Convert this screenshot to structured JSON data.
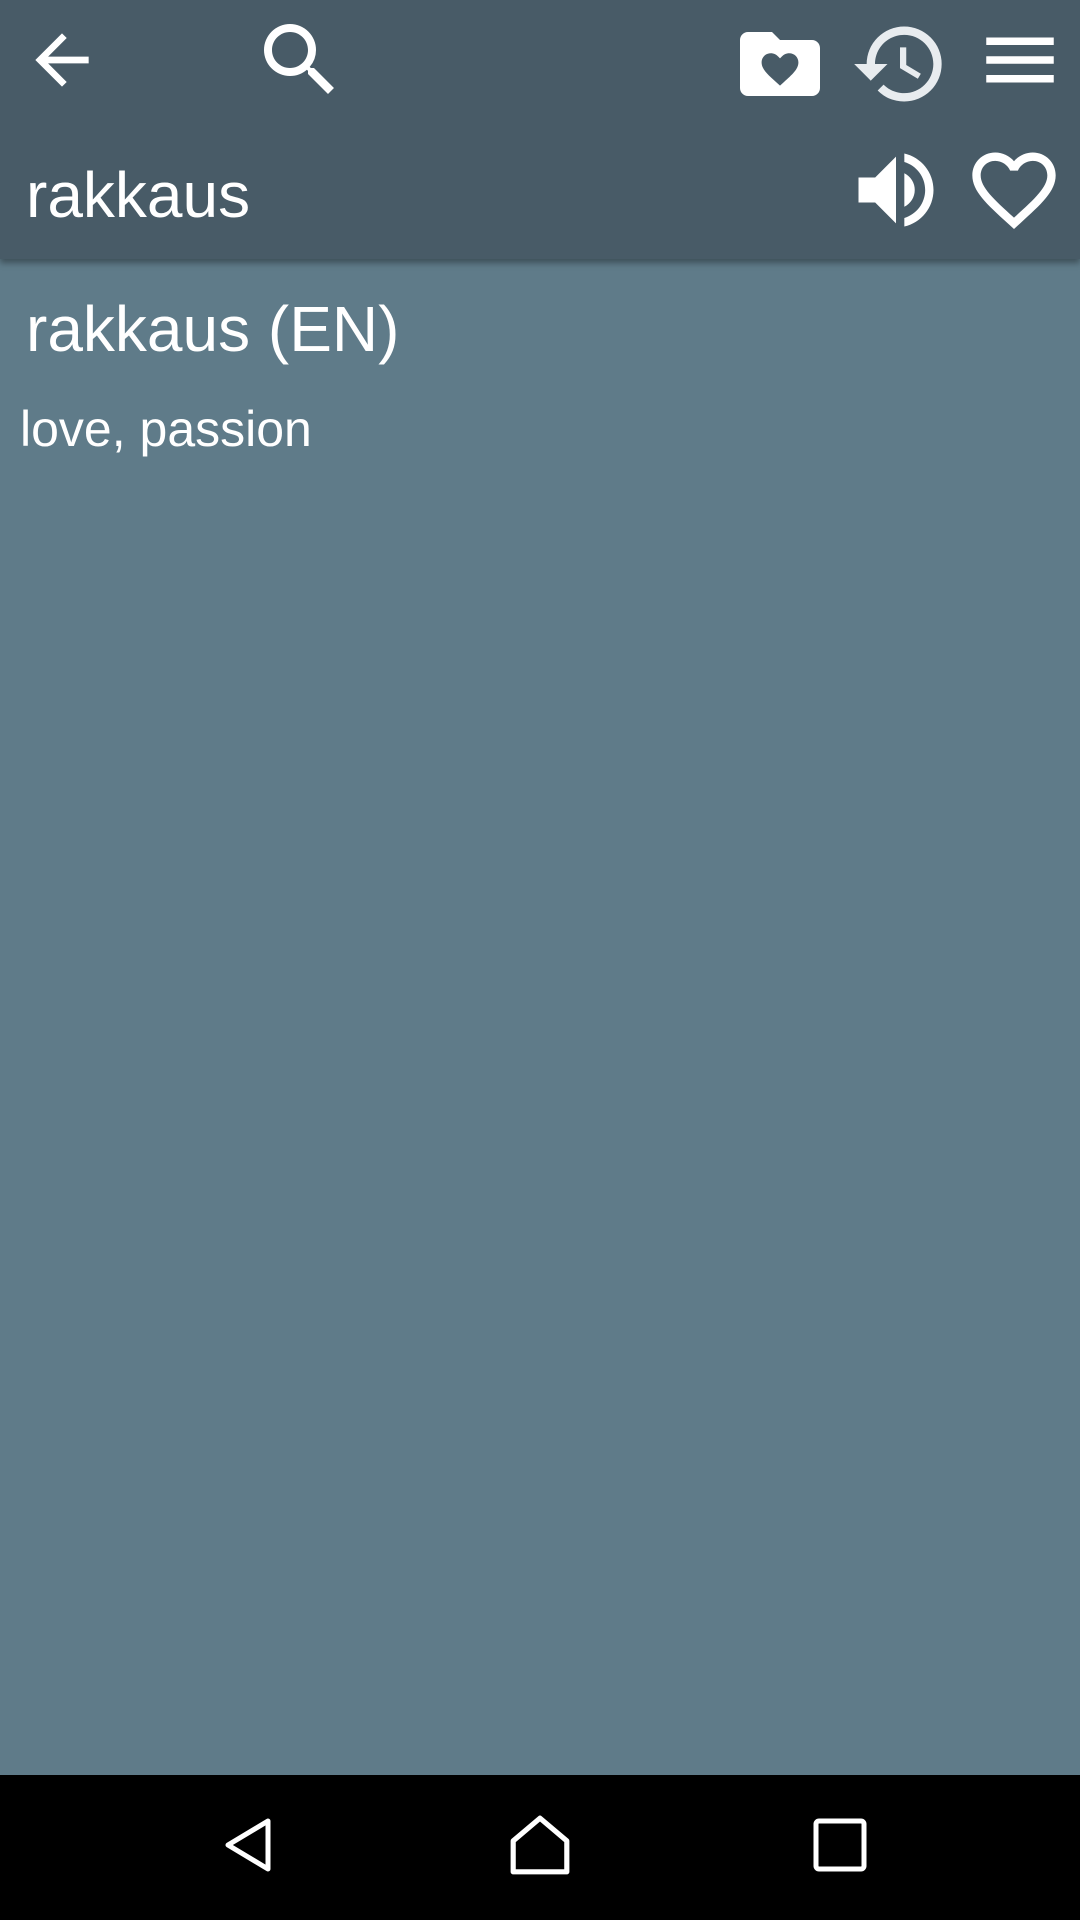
{
  "toolbar": {
    "back_icon": "arrow-left-icon",
    "search_icon": "search-icon",
    "favorites_folder_icon": "folder-heart-icon",
    "history_icon": "history-icon",
    "menu_icon": "menu-icon"
  },
  "word_bar": {
    "word": "rakkaus",
    "speak_icon": "speaker-icon",
    "favorite_icon": "heart-outline-icon"
  },
  "entry": {
    "heading": "rakkaus (EN)",
    "definition": "love, passion"
  },
  "system_nav": {
    "back_icon": "nav-back-icon",
    "home_icon": "nav-home-icon",
    "recents_icon": "nav-recents-icon"
  },
  "colors": {
    "appbar": "#485b67",
    "content_bg": "#5f7b89",
    "navbar": "#000000",
    "text": "#ffffff"
  }
}
